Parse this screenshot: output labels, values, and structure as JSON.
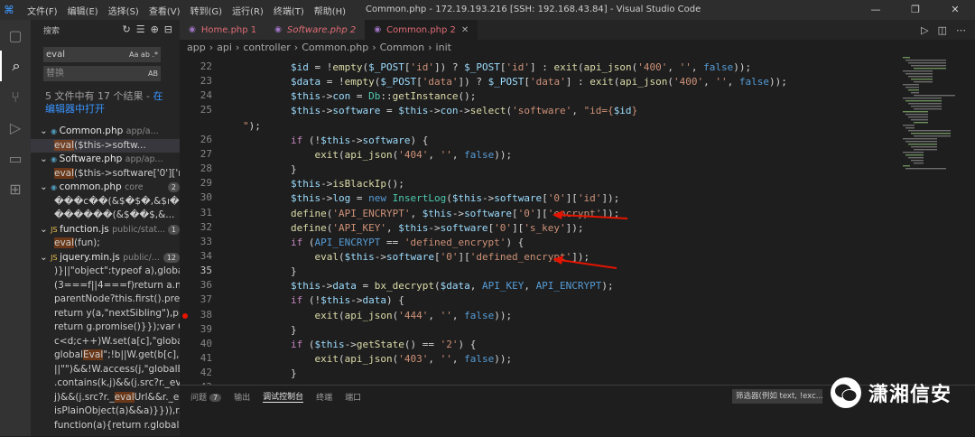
{
  "window": {
    "menu": [
      "文件(F)",
      "编辑(E)",
      "选择(S)",
      "查看(V)",
      "转到(G)",
      "运行(R)",
      "终端(T)",
      "帮助(H)"
    ],
    "title": "Common.php - 172.19.193.216 [SSH: 192.168.43.84] - Visual Studio Code",
    "controls": [
      "—",
      "❐",
      "✕"
    ]
  },
  "activity_icons": [
    "files-icon",
    "search-icon",
    "source-control-icon",
    "run-debug-icon",
    "remote-explorer-icon",
    "extensions-icon"
  ],
  "search": {
    "header": "搜索",
    "query": "eval",
    "query_opts": "Aa ab .*",
    "replace_placeholder": "替换",
    "replace_opts": "AB",
    "summary_text": "5 文件中有 17 个结果 - ",
    "summary_link": "在编辑器中打开",
    "files": [
      {
        "name": "Common.php",
        "path": "app/a...",
        "count": "",
        "matches": [
          "eval($this->softw..."
        ]
      },
      {
        "name": "Software.php",
        "path": "app/ap...",
        "count": "",
        "matches": [
          "eval($this->software['0']['re..."
        ]
      },
      {
        "name": "common.php",
        "path": "core",
        "count": "2",
        "matches": [
          "���c��(&$�$�,&$ı�,...",
          "������(&$��$,&..."
        ]
      },
      {
        "name": "function.js",
        "path": "public/stat...",
        "count": "1",
        "matches": [
          "eval(fun);"
        ]
      },
      {
        "name": "jquery.min.js",
        "path": "public/...",
        "count": "12",
        "matches": [
          ")}||\"object\":typeof a),global...",
          "(3===f||4===f)return a.no...",
          "parentNode?this.first().prev...",
          "return y(a,\"nextSibling\"),pr...",
          "return g.promise()}});var Q=...",
          "c<d;c++)W.set(a[c],\"global...",
          "globalEval\";!b||W.get(b[c],\"...",
          "||\"\")&&!W.access(j,\"globalE...",
          ".contains(k,j)&&(j.src?r._eva...",
          "j)&&(j.src?r._evalUrl&&r._e...",
          "isPlainObject(a)&&a)}})),r....",
          "function(a){return r.globalE..."
        ]
      }
    ]
  },
  "tabs": [
    {
      "label": "Home.php 1",
      "active": false
    },
    {
      "label": "Software.php 2",
      "active": false
    },
    {
      "label": "Common.php 2",
      "active": true
    }
  ],
  "breadcrumb": [
    "app",
    "api",
    "controller",
    "Common.php",
    "Common",
    "init"
  ],
  "line_numbers": [
    "22",
    "23",
    "24",
    "25",
    "",
    "26",
    "27",
    "28",
    "29",
    "30",
    "31",
    "32",
    "33",
    "34",
    "35",
    "36",
    "37",
    "38",
    "39",
    "40",
    "41",
    "42",
    "43"
  ],
  "code_lines": [
    [
      [
        "vr",
        "        $id"
      ],
      [
        "pl",
        " = !"
      ],
      [
        "fn",
        "empty"
      ],
      [
        "pl",
        "("
      ],
      [
        "vr",
        "$_POST"
      ],
      [
        "pl",
        "["
      ],
      [
        "str",
        "'id'"
      ],
      [
        "pl",
        "]) ? "
      ],
      [
        "vr",
        "$_POST"
      ],
      [
        "pl",
        "["
      ],
      [
        "str",
        "'id'"
      ],
      [
        "pl",
        "] : "
      ],
      [
        "fn",
        "exit"
      ],
      [
        "pl",
        "("
      ],
      [
        "fn",
        "api_json"
      ],
      [
        "pl",
        "("
      ],
      [
        "str",
        "'400'"
      ],
      [
        "pl",
        ", "
      ],
      [
        "str",
        "''"
      ],
      [
        "pl",
        ", "
      ],
      [
        "cst",
        "false"
      ],
      [
        "pl",
        "));"
      ]
    ],
    [
      [
        "vr",
        "        $data"
      ],
      [
        "pl",
        " = !"
      ],
      [
        "fn",
        "empty"
      ],
      [
        "pl",
        "("
      ],
      [
        "vr",
        "$_POST"
      ],
      [
        "pl",
        "["
      ],
      [
        "str",
        "'data'"
      ],
      [
        "pl",
        "]) ? "
      ],
      [
        "vr",
        "$_POST"
      ],
      [
        "pl",
        "["
      ],
      [
        "str",
        "'data'"
      ],
      [
        "pl",
        "] : "
      ],
      [
        "fn",
        "exit"
      ],
      [
        "pl",
        "("
      ],
      [
        "fn",
        "api_json"
      ],
      [
        "pl",
        "("
      ],
      [
        "str",
        "'400'"
      ],
      [
        "pl",
        ", "
      ],
      [
        "str",
        "''"
      ],
      [
        "pl",
        ", "
      ],
      [
        "cst",
        "false"
      ],
      [
        "pl",
        "));"
      ]
    ],
    [
      [
        "vr",
        "        $this"
      ],
      [
        "pl",
        "->"
      ],
      [
        "vr",
        "con"
      ],
      [
        "pl",
        " = "
      ],
      [
        "cls",
        "Db"
      ],
      [
        "pl",
        "::"
      ],
      [
        "fn",
        "getInstance"
      ],
      [
        "pl",
        "();"
      ]
    ],
    [
      [
        "vr",
        "        $this"
      ],
      [
        "pl",
        "->"
      ],
      [
        "vr",
        "software"
      ],
      [
        "pl",
        " = "
      ],
      [
        "vr",
        "$this"
      ],
      [
        "pl",
        "->"
      ],
      [
        "vr",
        "con"
      ],
      [
        "pl",
        "->"
      ],
      [
        "fn",
        "select"
      ],
      [
        "pl",
        "("
      ],
      [
        "str",
        "'software'"
      ],
      [
        "pl",
        ", "
      ],
      [
        "str",
        "\"id={"
      ],
      [
        "vr",
        "$id"
      ],
      [
        "str",
        "}"
      ]
    ],
    [
      [
        "str",
        "\""
      ],
      [
        "pl",
        ");"
      ]
    ],
    [
      [
        "kw",
        "        if"
      ],
      [
        "pl",
        " (!"
      ],
      [
        "vr",
        "$this"
      ],
      [
        "pl",
        "->"
      ],
      [
        "vr",
        "software"
      ],
      [
        "pl",
        ") {"
      ]
    ],
    [
      [
        "fn",
        "            exit"
      ],
      [
        "pl",
        "("
      ],
      [
        "fn",
        "api_json"
      ],
      [
        "pl",
        "("
      ],
      [
        "str",
        "'404'"
      ],
      [
        "pl",
        ", "
      ],
      [
        "str",
        "''"
      ],
      [
        "pl",
        ", "
      ],
      [
        "cst",
        "false"
      ],
      [
        "pl",
        "));"
      ]
    ],
    [
      [
        "pl",
        "        }"
      ]
    ],
    [
      [
        "vr",
        "        $this"
      ],
      [
        "pl",
        "->"
      ],
      [
        "fn",
        "isBlackIp"
      ],
      [
        "pl",
        "();"
      ]
    ],
    [
      [
        "vr",
        "        $this"
      ],
      [
        "pl",
        "->"
      ],
      [
        "vr",
        "log"
      ],
      [
        "pl",
        " = "
      ],
      [
        "cst",
        "new "
      ],
      [
        "cls",
        "InsertLog"
      ],
      [
        "pl",
        "("
      ],
      [
        "vr",
        "$this"
      ],
      [
        "pl",
        "->"
      ],
      [
        "vr",
        "software"
      ],
      [
        "pl",
        "["
      ],
      [
        "str",
        "'0'"
      ],
      [
        "pl",
        "]["
      ],
      [
        "str",
        "'id'"
      ],
      [
        "pl",
        "]);"
      ]
    ],
    [
      [
        "fn",
        "        define"
      ],
      [
        "pl",
        "("
      ],
      [
        "str",
        "'API_ENCRYPT'"
      ],
      [
        "pl",
        ", "
      ],
      [
        "vr",
        "$this"
      ],
      [
        "pl",
        "->"
      ],
      [
        "vr",
        "software"
      ],
      [
        "pl",
        "["
      ],
      [
        "str",
        "'0'"
      ],
      [
        "pl",
        "]["
      ],
      [
        "str",
        "'encrypt'"
      ],
      [
        "pl",
        "]);"
      ]
    ],
    [
      [
        "fn",
        "        define"
      ],
      [
        "pl",
        "("
      ],
      [
        "str",
        "'API_KEY'"
      ],
      [
        "pl",
        ", "
      ],
      [
        "vr",
        "$this"
      ],
      [
        "pl",
        "->"
      ],
      [
        "vr",
        "software"
      ],
      [
        "pl",
        "["
      ],
      [
        "str",
        "'0'"
      ],
      [
        "pl",
        "]["
      ],
      [
        "str",
        "'s_key'"
      ],
      [
        "pl",
        "]);"
      ]
    ],
    [
      [
        "kw",
        "        if"
      ],
      [
        "pl",
        " ("
      ],
      [
        "cst",
        "API_ENCRYPT"
      ],
      [
        "pl",
        " == "
      ],
      [
        "str",
        "'defined_encrypt'"
      ],
      [
        "pl",
        ") {"
      ]
    ],
    [
      [
        "fn",
        "            eval"
      ],
      [
        "pl",
        "("
      ],
      [
        "vr",
        "$this"
      ],
      [
        "pl",
        "->"
      ],
      [
        "vr",
        "software"
      ],
      [
        "pl",
        "["
      ],
      [
        "str",
        "'0'"
      ],
      [
        "pl",
        "]["
      ],
      [
        "str",
        "'defined_encrypt'"
      ],
      [
        "pl",
        "]);"
      ]
    ],
    [
      [
        "pl",
        "        }"
      ]
    ],
    [
      [
        "vr",
        "        $this"
      ],
      [
        "pl",
        "->"
      ],
      [
        "vr",
        "data"
      ],
      [
        "pl",
        " = "
      ],
      [
        "fn",
        "bx_decrypt"
      ],
      [
        "pl",
        "("
      ],
      [
        "vr",
        "$data"
      ],
      [
        "pl",
        ", "
      ],
      [
        "cst",
        "API_KEY"
      ],
      [
        "pl",
        ", "
      ],
      [
        "cst",
        "API_ENCRYPT"
      ],
      [
        "pl",
        ");"
      ]
    ],
    [
      [
        "kw",
        "        if"
      ],
      [
        "pl",
        " (!"
      ],
      [
        "vr",
        "$this"
      ],
      [
        "pl",
        "->"
      ],
      [
        "vr",
        "data"
      ],
      [
        "pl",
        ") {"
      ]
    ],
    [
      [
        "fn",
        "            exit"
      ],
      [
        "pl",
        "("
      ],
      [
        "fn",
        "api_json"
      ],
      [
        "pl",
        "("
      ],
      [
        "str",
        "'444'"
      ],
      [
        "pl",
        ", "
      ],
      [
        "str",
        "''"
      ],
      [
        "pl",
        ", "
      ],
      [
        "cst",
        "false"
      ],
      [
        "pl",
        "));"
      ]
    ],
    [
      [
        "pl",
        "        }"
      ]
    ],
    [
      [
        "kw",
        "        if"
      ],
      [
        "pl",
        " ("
      ],
      [
        "vr",
        "$this"
      ],
      [
        "pl",
        "->"
      ],
      [
        "fn",
        "getState"
      ],
      [
        "pl",
        "() == "
      ],
      [
        "str",
        "'2'"
      ],
      [
        "pl",
        ") {"
      ]
    ],
    [
      [
        "fn",
        "            exit"
      ],
      [
        "pl",
        "("
      ],
      [
        "fn",
        "api_json"
      ],
      [
        "pl",
        "("
      ],
      [
        "str",
        "'403'"
      ],
      [
        "pl",
        ", "
      ],
      [
        "str",
        "''"
      ],
      [
        "pl",
        ", "
      ],
      [
        "cst",
        "false"
      ],
      [
        "pl",
        "));"
      ]
    ],
    [
      [
        "pl",
        "        }"
      ]
    ]
  ],
  "panel": {
    "tabs": [
      {
        "label": "问题",
        "badge": "7",
        "active": false
      },
      {
        "label": "输出",
        "badge": "",
        "active": false
      },
      {
        "label": "调试控制台",
        "badge": "",
        "active": true
      },
      {
        "label": "终端",
        "badge": "",
        "active": false
      },
      {
        "label": "端口",
        "badge": "",
        "active": false
      }
    ],
    "filter_placeholder": "筛选器(例如 text, !exc..."
  },
  "watermark": {
    "text": "潇湘信安"
  },
  "colors": {
    "accent": "#3794ff",
    "arrow": "#e51400",
    "tab_modified": "#e06c75"
  }
}
